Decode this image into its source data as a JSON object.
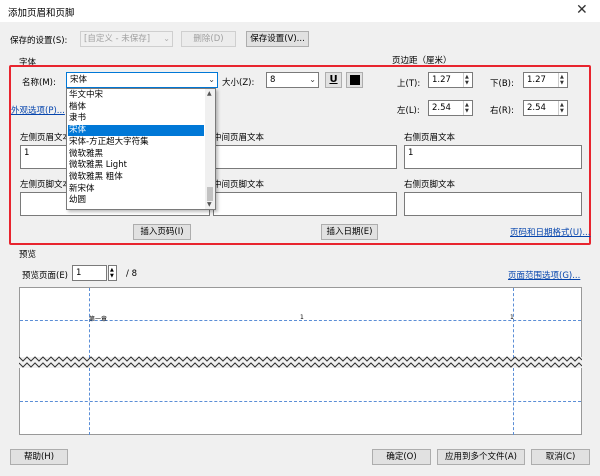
{
  "window": {
    "title": "添加页眉和页脚",
    "close_glyph": "✕"
  },
  "saved_settings": {
    "label": "保存的设置(S):",
    "value": "[自定义 - 未保存]",
    "delete_label": "删除(D)",
    "save_label": "保存设置(V)..."
  },
  "font": {
    "section_label": "字体",
    "name_label": "名称(M):",
    "name_value": "宋体",
    "size_label": "大小(Z):",
    "size_value": "8",
    "underline_glyph": "U",
    "color": "#000000",
    "appearance_link": "外观选项(P)..."
  },
  "font_list": {
    "items": [
      "华文中宋",
      "楷体",
      "隶书",
      "宋体",
      "宋体-方正超大字符集",
      "微软雅黑",
      "微软雅黑 Light",
      "微软雅黑 粗体",
      "新宋体",
      "幼圆"
    ],
    "selected": "宋体"
  },
  "margins": {
    "section_label": "页边距（厘米）",
    "top_label": "上(T):",
    "top_value": "1.27",
    "bottom_label": "下(B):",
    "bottom_value": "1.27",
    "left_label": "左(L):",
    "left_value": "2.54",
    "right_label": "右(R):",
    "right_value": "2.54"
  },
  "header": {
    "left_label": "左侧页眉文本",
    "left_value": "1",
    "center_label": "中间页眉文本",
    "center_value": "",
    "right_label": "右侧页眉文本",
    "right_value": "1"
  },
  "footer": {
    "left_label": "左侧页脚文本",
    "left_value": "",
    "center_label": "中间页脚文本",
    "center_value": "",
    "right_label": "右侧页脚文本",
    "right_value": ""
  },
  "insert": {
    "page_number": "插入页码(I)",
    "date": "插入日期(E)",
    "format_link": "页码和日期格式(U)..."
  },
  "preview": {
    "section_label": "预览",
    "page_label": "预览页面(E)",
    "page_value": "1",
    "page_total": "/ 8",
    "range_link": "页面范围选项(G)...",
    "header_left": "第一章",
    "header_center": "1",
    "header_right": "1"
  },
  "footer_buttons": {
    "help": "帮助(H)",
    "ok": "确定(O)",
    "apply_multiple": "应用到多个文件(A)",
    "cancel": "取消(C)"
  },
  "colors": {
    "highlight_border": "#e8242e",
    "selection": "#0078d7",
    "link": "#0645ad",
    "guide": "#5b8ed6"
  }
}
